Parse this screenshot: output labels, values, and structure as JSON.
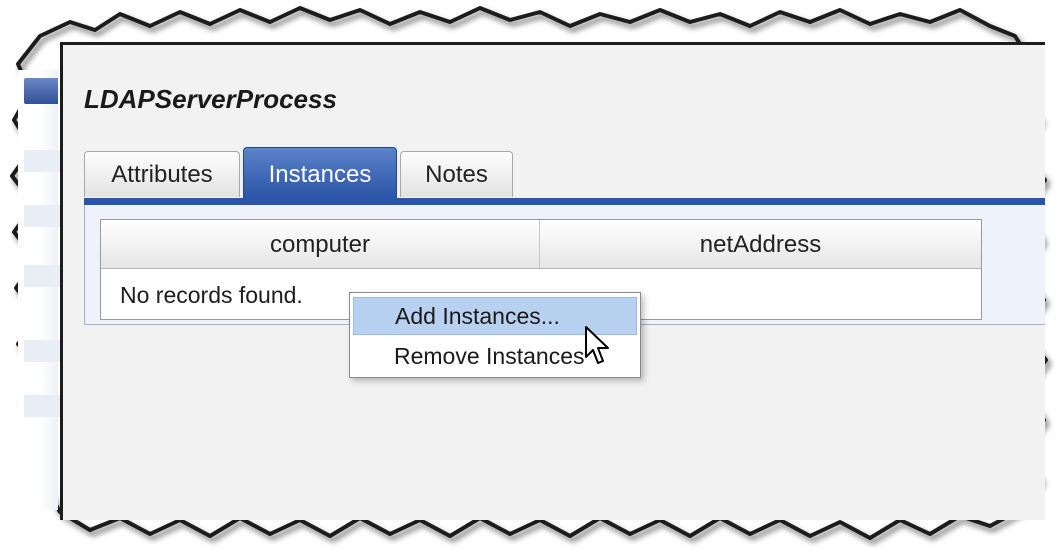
{
  "window": {
    "title": "LDAPServerProcess"
  },
  "tabs": [
    {
      "label": "Attributes",
      "active": false
    },
    {
      "label": "Instances",
      "active": true
    },
    {
      "label": "Notes",
      "active": false
    }
  ],
  "grid": {
    "columns": [
      "computer",
      "netAddress"
    ],
    "empty_message": "No records found."
  },
  "context_menu": {
    "items": [
      {
        "label": "Add Instances...",
        "highlighted": true
      },
      {
        "label": "Remove Instances"
      }
    ]
  },
  "colors": {
    "active_tab": "#2b55a9",
    "menu_highlight": "#b9d1f1",
    "panel_background": "#f2f2f2"
  },
  "icons": {
    "pointer": "mouse-pointer-icon"
  }
}
